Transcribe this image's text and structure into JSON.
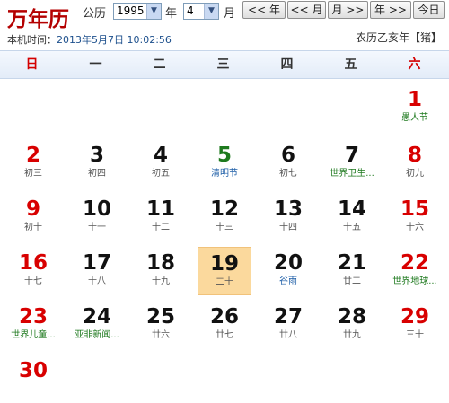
{
  "header": {
    "title": "万年历",
    "calendar_label": "公历",
    "year_value": "1995",
    "year_unit": "年",
    "month_value": "4",
    "month_unit": "月",
    "buttons": {
      "prev_year": "<< 年",
      "prev_month": "<< 月",
      "next_month": "月 >>",
      "next_year": "年 >>",
      "today": "今日"
    },
    "local_time_label": "本机时间：",
    "local_time_value": "2013年5月7日 10:02:56",
    "lunar_info": "农历乙亥年【猪】"
  },
  "weekdays": [
    "日",
    "一",
    "二",
    "三",
    "四",
    "五",
    "六"
  ],
  "days": [
    {
      "day": "1",
      "sub": "愚人节",
      "num_style": "red",
      "sub_style": "fest"
    },
    {
      "day": "2",
      "sub": "初三",
      "num_style": "red",
      "sub_style": ""
    },
    {
      "day": "3",
      "sub": "初四",
      "num_style": "",
      "sub_style": ""
    },
    {
      "day": "4",
      "sub": "初五",
      "num_style": "",
      "sub_style": ""
    },
    {
      "day": "5",
      "sub": "清明节",
      "num_style": "green",
      "sub_style": "term"
    },
    {
      "day": "6",
      "sub": "初七",
      "num_style": "",
      "sub_style": ""
    },
    {
      "day": "7",
      "sub": "世界卫生...",
      "num_style": "",
      "sub_style": "fest"
    },
    {
      "day": "8",
      "sub": "初九",
      "num_style": "red",
      "sub_style": ""
    },
    {
      "day": "9",
      "sub": "初十",
      "num_style": "red",
      "sub_style": ""
    },
    {
      "day": "10",
      "sub": "十一",
      "num_style": "",
      "sub_style": ""
    },
    {
      "day": "11",
      "sub": "十二",
      "num_style": "",
      "sub_style": ""
    },
    {
      "day": "12",
      "sub": "十三",
      "num_style": "",
      "sub_style": ""
    },
    {
      "day": "13",
      "sub": "十四",
      "num_style": "",
      "sub_style": ""
    },
    {
      "day": "14",
      "sub": "十五",
      "num_style": "",
      "sub_style": ""
    },
    {
      "day": "15",
      "sub": "十六",
      "num_style": "red",
      "sub_style": ""
    },
    {
      "day": "16",
      "sub": "十七",
      "num_style": "red",
      "sub_style": ""
    },
    {
      "day": "17",
      "sub": "十八",
      "num_style": "",
      "sub_style": ""
    },
    {
      "day": "18",
      "sub": "十九",
      "num_style": "",
      "sub_style": ""
    },
    {
      "day": "19",
      "sub": "二十",
      "num_style": "",
      "sub_style": "",
      "today": true
    },
    {
      "day": "20",
      "sub": "谷雨",
      "num_style": "",
      "sub_style": "term"
    },
    {
      "day": "21",
      "sub": "廿二",
      "num_style": "",
      "sub_style": ""
    },
    {
      "day": "22",
      "sub": "世界地球...",
      "num_style": "red",
      "sub_style": "fest"
    },
    {
      "day": "23",
      "sub": "世界儿童...",
      "num_style": "red",
      "sub_style": "fest"
    },
    {
      "day": "24",
      "sub": "亚非新闻...",
      "num_style": "",
      "sub_style": "fest"
    },
    {
      "day": "25",
      "sub": "廿六",
      "num_style": "",
      "sub_style": ""
    },
    {
      "day": "26",
      "sub": "廿七",
      "num_style": "",
      "sub_style": ""
    },
    {
      "day": "27",
      "sub": "廿八",
      "num_style": "",
      "sub_style": ""
    },
    {
      "day": "28",
      "sub": "廿九",
      "num_style": "",
      "sub_style": ""
    },
    {
      "day": "29",
      "sub": "三十",
      "num_style": "red",
      "sub_style": ""
    },
    {
      "day": "30",
      "sub": "",
      "num_style": "red",
      "sub_style": ""
    }
  ],
  "first_weekday_index": 6,
  "colors": {
    "weekend_red": "#d80000",
    "festival_green": "#1f7a1f",
    "solar_term_blue": "#1f5fa8",
    "today_bg": "#fbd99d"
  }
}
